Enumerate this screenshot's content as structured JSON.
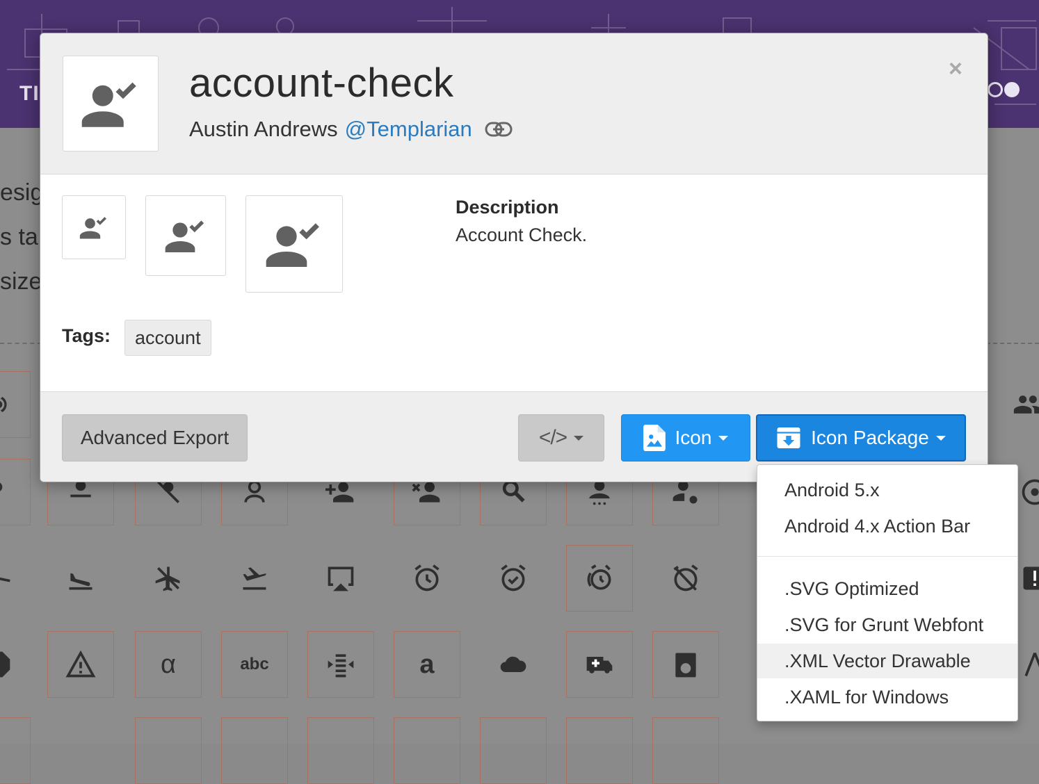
{
  "background": {
    "brand": "TI",
    "text_lines": [
      "esig",
      "s tar",
      "size"
    ]
  },
  "modal": {
    "title": "account-check",
    "author": "Austin Andrews",
    "author_handle": "@Templarian",
    "description_label": "Description",
    "description": "Account Check.",
    "tags_label": "Tags:",
    "tags": [
      "account"
    ],
    "close_glyph": "×",
    "footer": {
      "advanced_export": "Advanced Export",
      "code_glyph": "</>",
      "icon_button": "Icon",
      "icon_package_button": "Icon Package"
    }
  },
  "dropdown": {
    "group1": [
      "Android 5.x",
      "Android 4.x Action Bar"
    ],
    "group2": [
      ".SVG Optimized",
      ".SVG for Grunt Webfont",
      ".XML Vector Drawable",
      ".XAML for Windows"
    ],
    "highlighted": ".XML Vector Drawable"
  },
  "colors": {
    "header_purple": "#4b3270",
    "primary_blue": "#2196f3",
    "link_blue": "#2a7bbf",
    "icon_gray": "#616161"
  },
  "icons": {
    "main": "account-check-icon",
    "link": "link-icon",
    "file_image": "file-image-icon",
    "package": "package-down-icon",
    "close": "close-icon"
  }
}
